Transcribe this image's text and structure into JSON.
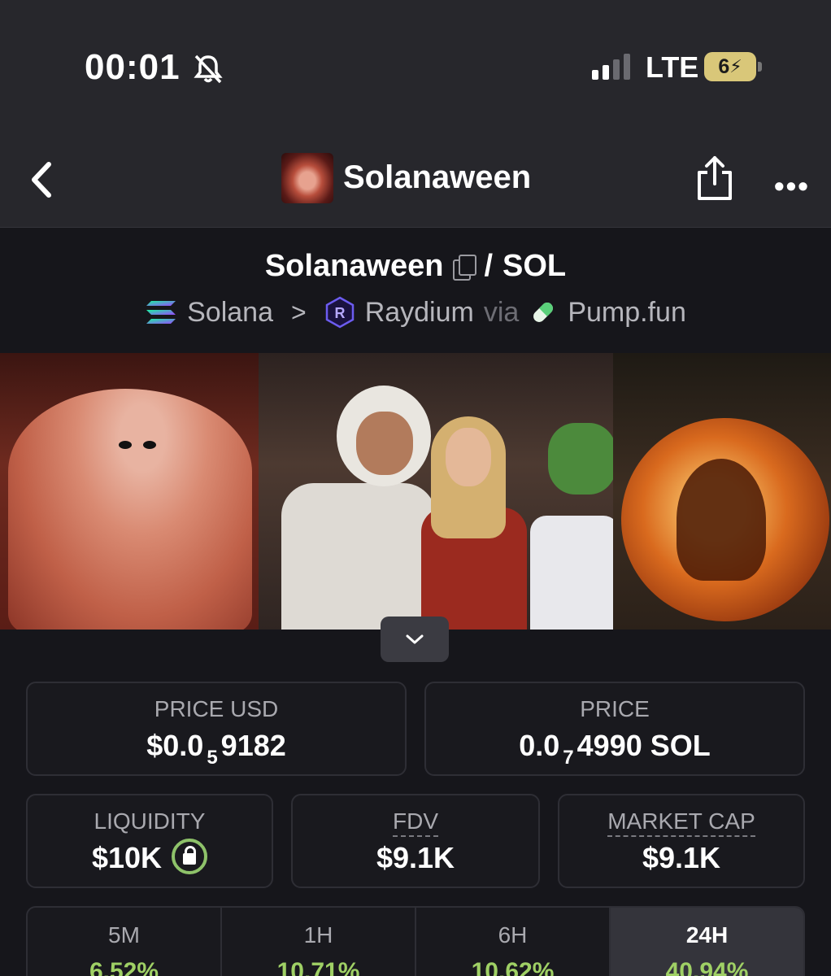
{
  "status_bar": {
    "time": "00:01",
    "network": "LTE",
    "battery": "6"
  },
  "nav": {
    "title": "Solanaween"
  },
  "pair": {
    "token": "Solanaween",
    "separator": "/",
    "quote": "SOL",
    "chain": "Solana",
    "dex": "Raydium",
    "via": "via",
    "launchpad": "Pump.fun"
  },
  "stats": {
    "price_usd": {
      "label": "PRICE USD",
      "prefix": "$0.0",
      "zeros": "5",
      "digits": "9182"
    },
    "price_sol": {
      "label": "PRICE",
      "prefix": "0.0",
      "zeros": "7",
      "digits": "4990 SOL"
    },
    "liquidity": {
      "label": "LIQUIDITY",
      "value": "$10K"
    },
    "fdv": {
      "label": "FDV",
      "value": "$9.1K"
    },
    "market_cap": {
      "label": "MARKET CAP",
      "value": "$9.1K"
    }
  },
  "timeframes": [
    {
      "label": "5M",
      "value": "6.52%"
    },
    {
      "label": "1H",
      "value": "10.71%"
    },
    {
      "label": "6H",
      "value": "10.62%"
    },
    {
      "label": "24H",
      "value": "40.94%"
    }
  ],
  "colors": {
    "background": "#16161b",
    "header": "#27272c",
    "positive": "#9fd065",
    "lock": "#8ec26a"
  }
}
